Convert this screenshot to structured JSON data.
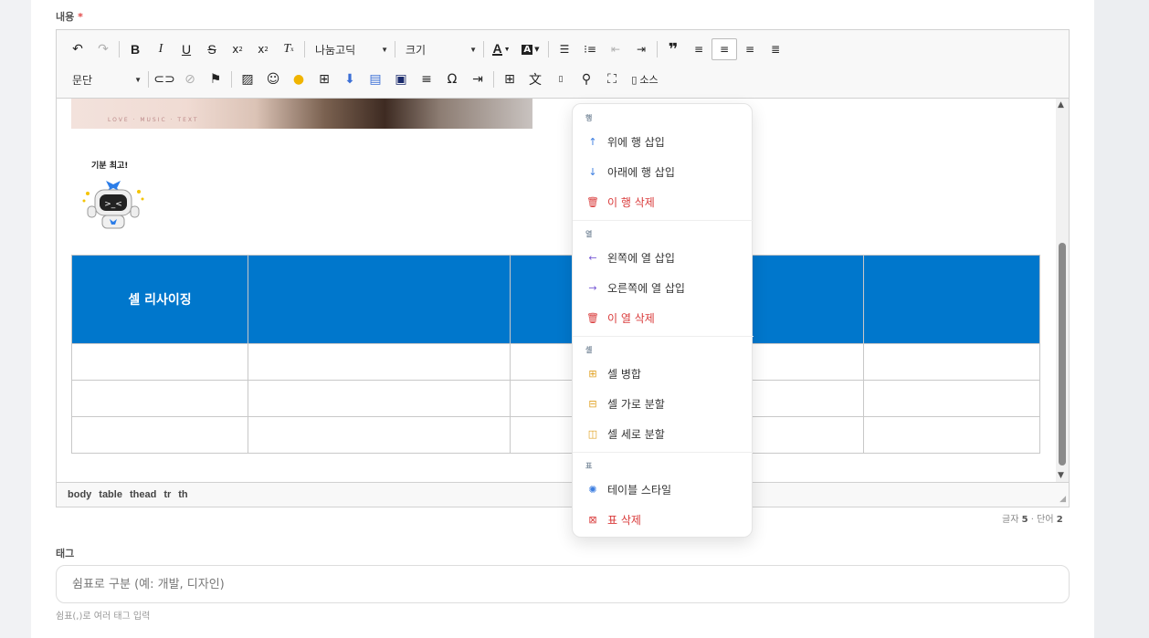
{
  "labels": {
    "content": "내용",
    "required_mark": "*",
    "tags": "태그",
    "tags_hint": "쉼표(,)로 여러 태그 입력"
  },
  "toolbar": {
    "font_family": "나눔고딕",
    "font_size": "크기",
    "format": "문단",
    "source_label": "소스"
  },
  "content": {
    "photo_caption": "LOVE · MUSIC · TEXT",
    "sticker_caption": "기분 최고!",
    "table": {
      "header": [
        "셀 리사이징",
        "",
        "",
        "",
        ""
      ],
      "rows": [
        [
          "",
          "",
          "",
          "",
          ""
        ],
        [
          "",
          "",
          "",
          "",
          ""
        ],
        [
          "",
          "",
          "",
          "",
          ""
        ]
      ]
    }
  },
  "statusbar": {
    "path": [
      "body",
      "table",
      "thead",
      "tr",
      "th"
    ]
  },
  "word_count": {
    "chars_label": "글자",
    "chars": "5",
    "sep": "·",
    "words_label": "단어",
    "words": "2"
  },
  "tag_input": {
    "placeholder": "쉼표로 구분 (예: 개발, 디자인)",
    "value": ""
  },
  "context_menu": {
    "sections": [
      {
        "title": "행",
        "items": [
          {
            "label": "위에 행 삽입",
            "icon": "arrow-up-icon",
            "danger": false
          },
          {
            "label": "아래에 행 삽입",
            "icon": "arrow-down-icon",
            "danger": false
          },
          {
            "label": "이 행 삭제",
            "icon": "trash-icon",
            "danger": true
          }
        ]
      },
      {
        "title": "열",
        "items": [
          {
            "label": "왼쪽에 열 삽입",
            "icon": "arrow-left-icon",
            "danger": false
          },
          {
            "label": "오른쪽에 열 삽입",
            "icon": "arrow-right-icon",
            "danger": false
          },
          {
            "label": "이 열 삭제",
            "icon": "trash-icon",
            "danger": true
          }
        ]
      },
      {
        "title": "셀",
        "items": [
          {
            "label": "셀 병합",
            "icon": "merge-cells-icon",
            "danger": false
          },
          {
            "label": "셀 가로 분할",
            "icon": "split-horizontal-icon",
            "danger": false
          },
          {
            "label": "셀 세로 분할",
            "icon": "split-vertical-icon",
            "danger": false
          }
        ]
      },
      {
        "title": "표",
        "items": [
          {
            "label": "테이블 스타일",
            "icon": "style-icon",
            "danger": false
          },
          {
            "label": "표 삭제",
            "icon": "delete-table-icon",
            "danger": true
          }
        ]
      }
    ]
  },
  "colors": {
    "table_header": "#0077cc",
    "danger": "#d93a3a",
    "accent_blue": "#3b7de0",
    "accent_purple": "#7b5cd6",
    "accent_orange": "#e0a020"
  }
}
